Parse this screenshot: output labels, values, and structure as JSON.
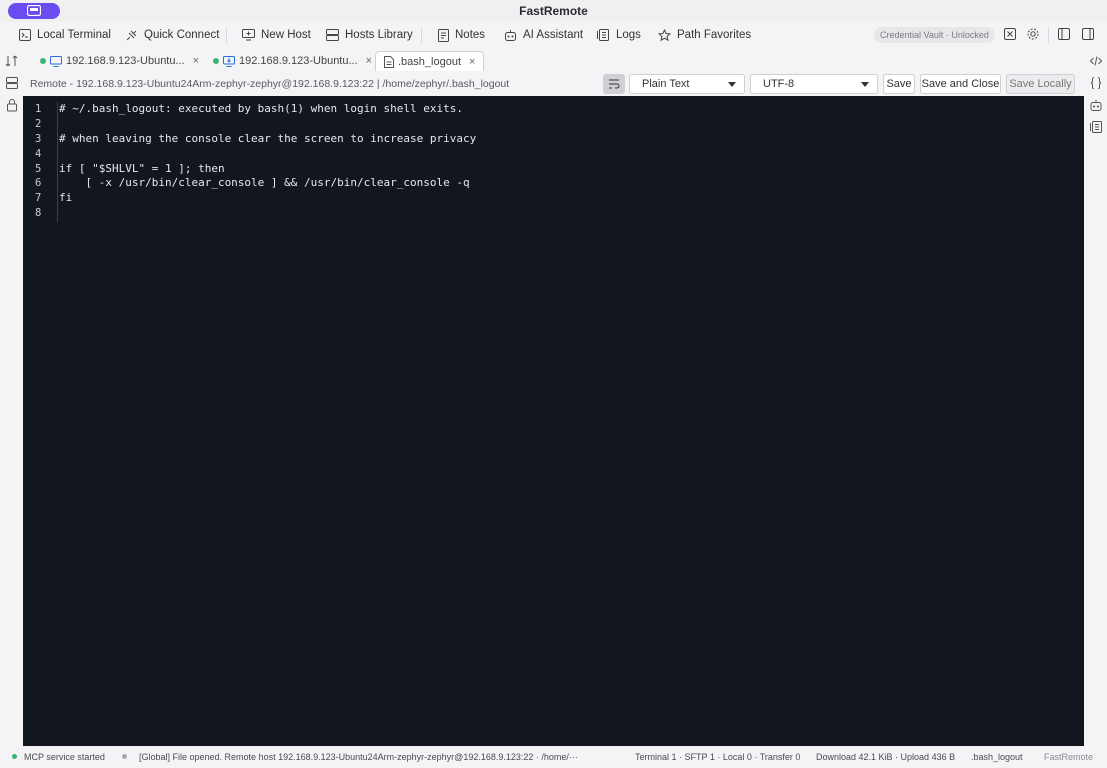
{
  "window": {
    "title": "FastRemote"
  },
  "toolbar": {
    "local_terminal": "Local Terminal",
    "quick_connect": "Quick Connect",
    "new_host": "New Host",
    "hosts_library": "Hosts Library",
    "notes": "Notes",
    "ai_assistant": "AI Assistant",
    "logs": "Logs",
    "path_favorites": "Path Favorites",
    "vault_status": "Credential Vault · Unlocked"
  },
  "tabs": [
    {
      "label": "192.168.9.123-Ubuntu...",
      "close": "×",
      "kind": "terminal"
    },
    {
      "label": "192.168.9.123-Ubuntu...",
      "close": "×",
      "kind": "sftp"
    },
    {
      "label": ".bash_logout",
      "close": "×",
      "kind": "file",
      "active": true
    }
  ],
  "pathbar": {
    "path": "Remote - 192.168.9.123-Ubuntu24Arm-zephyr-zephyr@192.168.9.123:22 | /home/zephyr/.bash_logout",
    "syntax": "Plain Text",
    "encoding": "UTF-8",
    "save": "Save",
    "save_close": "Save and Close",
    "save_locally": "Save Locally"
  },
  "editor": {
    "lines": [
      {
        "n": "1",
        "text": "# ~/.bash_logout: executed by bash(1) when login shell exits."
      },
      {
        "n": "2",
        "text": ""
      },
      {
        "n": "3",
        "text": "# when leaving the console clear the screen to increase privacy"
      },
      {
        "n": "4",
        "text": ""
      },
      {
        "n": "5",
        "text": "if [ \"$SHLVL\" = 1 ]; then"
      },
      {
        "n": "6",
        "text": "    [ -x /usr/bin/clear_console ] && /usr/bin/clear_console -q"
      },
      {
        "n": "7",
        "text": "fi"
      },
      {
        "n": "8",
        "text": ""
      }
    ]
  },
  "status": {
    "mcp": "MCP service started",
    "message": "[Global] File opened. Remote host 192.168.9.123-Ubuntu24Arm-zephyr-zephyr@192.168.9.123:22 · /home/···",
    "counts": "Terminal 1 · SFTP 1 · Local 0 · Transfer 0",
    "traffic": "Download 42.1 KiB · Upload 436 B",
    "file": ".bash_logout",
    "brand": "FastRemote"
  },
  "colors": {
    "accent": "#6a4cf0",
    "editor_bg": "#12161e",
    "status_ok": "#3cb371"
  }
}
